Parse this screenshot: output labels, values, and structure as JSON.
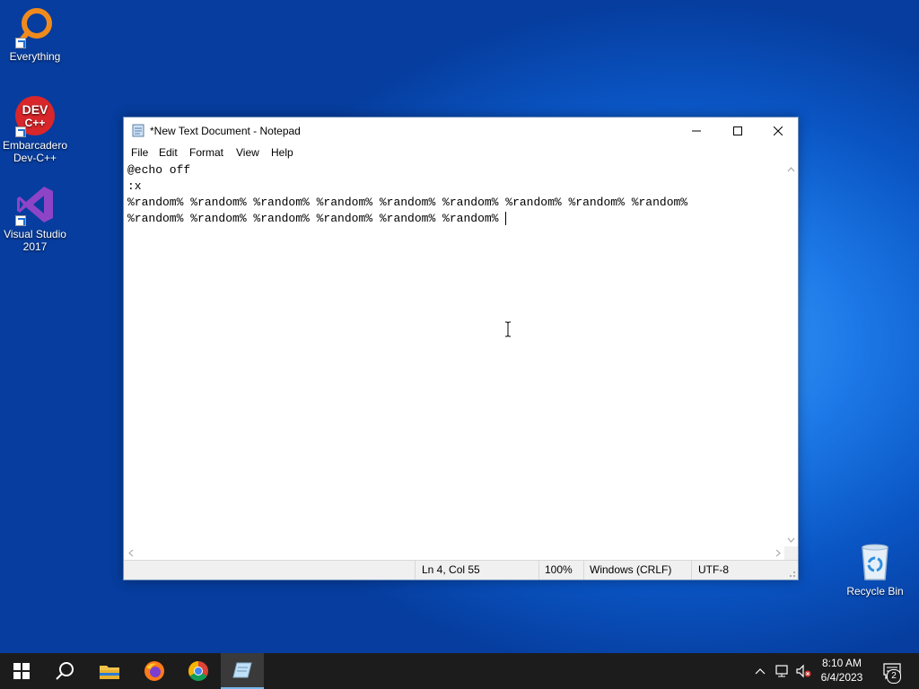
{
  "desktop": {
    "icons": [
      {
        "label": "Everything"
      },
      {
        "label": "Embarcadero Dev-C++"
      },
      {
        "label": "Visual Studio 2017"
      },
      {
        "label": "Recycle Bin"
      }
    ]
  },
  "notepad": {
    "title": "*New Text Document - Notepad",
    "menu": [
      "File",
      "Edit",
      "Format",
      "View",
      "Help"
    ],
    "lines": [
      "@echo off",
      ":x",
      "%random% %random% %random% %random% %random% %random% %random% %random% %random%",
      "%random% %random% %random% %random% %random% %random% "
    ],
    "status": {
      "position": "Ln 4, Col 55",
      "zoom": "100%",
      "line_ending": "Windows (CRLF)",
      "encoding": "UTF-8"
    }
  },
  "taskbar": {
    "clock_time": "8:10 AM",
    "clock_date": "6/4/2023",
    "notification_count": "2"
  },
  "colors": {
    "taskbar": "#1c1c1c",
    "accent": "#76b9ed",
    "desktop": "#1c78e6"
  }
}
